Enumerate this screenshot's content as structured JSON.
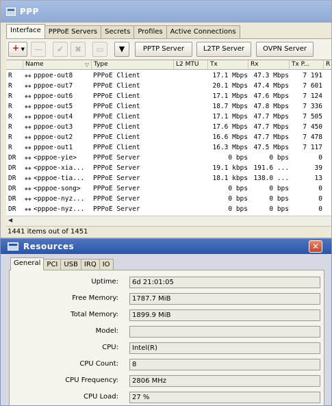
{
  "ppp": {
    "title": "PPP",
    "tabs": [
      "Interface",
      "PPPoE Servers",
      "Secrets",
      "Profiles",
      "Active Connections"
    ],
    "toolbar": {
      "pptp": "PPTP Server",
      "l2tp": "L2TP Server",
      "ovpn": "OVPN Server"
    },
    "columns": [
      "Name",
      "Type",
      "L2 MTU",
      "Tx",
      "Rx",
      "Tx P...",
      "R"
    ],
    "rows": [
      {
        "flag": "R",
        "name": "pppoe-out8",
        "type": "PPPoE Client",
        "tx": "17.1 Mbps",
        "rx": "47.3 Mbps",
        "txp": "7 191"
      },
      {
        "flag": "R",
        "name": "pppoe-out7",
        "type": "PPPoE Client",
        "tx": "20.1 Mbps",
        "rx": "47.4 Mbps",
        "txp": "7 601"
      },
      {
        "flag": "R",
        "name": "pppoe-out6",
        "type": "PPPoE Client",
        "tx": "17.1 Mbps",
        "rx": "47.6 Mbps",
        "txp": "7 124"
      },
      {
        "flag": "R",
        "name": "pppoe-out5",
        "type": "PPPoE Client",
        "tx": "18.7 Mbps",
        "rx": "47.8 Mbps",
        "txp": "7 336"
      },
      {
        "flag": "R",
        "name": "pppoe-out4",
        "type": "PPPoE Client",
        "tx": "17.1 Mbps",
        "rx": "47.7 Mbps",
        "txp": "7 505"
      },
      {
        "flag": "R",
        "name": "pppoe-out3",
        "type": "PPPoE Client",
        "tx": "17.6 Mbps",
        "rx": "47.7 Mbps",
        "txp": "7 450"
      },
      {
        "flag": "R",
        "name": "pppoe-out2",
        "type": "PPPoE Client",
        "tx": "16.6 Mbps",
        "rx": "47.7 Mbps",
        "txp": "7 478"
      },
      {
        "flag": "R",
        "name": "pppoe-out1",
        "type": "PPPoE Client",
        "tx": "16.3 Mbps",
        "rx": "47.5 Mbps",
        "txp": "7 117"
      },
      {
        "flag": "DR",
        "name": "<pppoe-yie>",
        "type": "PPPoE Server",
        "tx": "0 bps",
        "rx": "0 bps",
        "txp": "0"
      },
      {
        "flag": "DR",
        "name": "<pppoe-xia...",
        "type": "PPPoE Server",
        "tx": "19.1 kbps",
        "rx": "191.6 ...",
        "txp": "39"
      },
      {
        "flag": "DR",
        "name": "<pppoe-tia...",
        "type": "PPPoE Server",
        "tx": "18.1 kbps",
        "rx": "138.0 ...",
        "txp": "13"
      },
      {
        "flag": "DR",
        "name": "<pppoe-song>",
        "type": "PPPoE Server",
        "tx": "0 bps",
        "rx": "0 bps",
        "txp": "0"
      },
      {
        "flag": "DR",
        "name": "<pppoe-nyz...",
        "type": "PPPoE Server",
        "tx": "0 bps",
        "rx": "0 bps",
        "txp": "0"
      },
      {
        "flag": "DR",
        "name": "<pppoe-nyz...",
        "type": "PPPoE Server",
        "tx": "0 bps",
        "rx": "0 bps",
        "txp": "0"
      }
    ],
    "status": "1441 items out of 1451"
  },
  "resources": {
    "title": "Resources",
    "tabs": [
      "General",
      "PCI",
      "USB",
      "IRQ",
      "IO"
    ],
    "fields": [
      {
        "label": "Uptime:",
        "value": "6d 21:01:05"
      },
      {
        "label": "Free Memory:",
        "value": "1787.7 MiB"
      },
      {
        "label": "Total Memory:",
        "value": "1899.9 MiB"
      },
      {
        "label": "Model:",
        "value": ""
      },
      {
        "label": "CPU:",
        "value": "Intel(R)"
      },
      {
        "label": "CPU Count:",
        "value": "8"
      },
      {
        "label": "CPU Frequency:",
        "value": "2806 MHz"
      },
      {
        "label": "CPU Load:",
        "value": "27 %"
      }
    ]
  }
}
